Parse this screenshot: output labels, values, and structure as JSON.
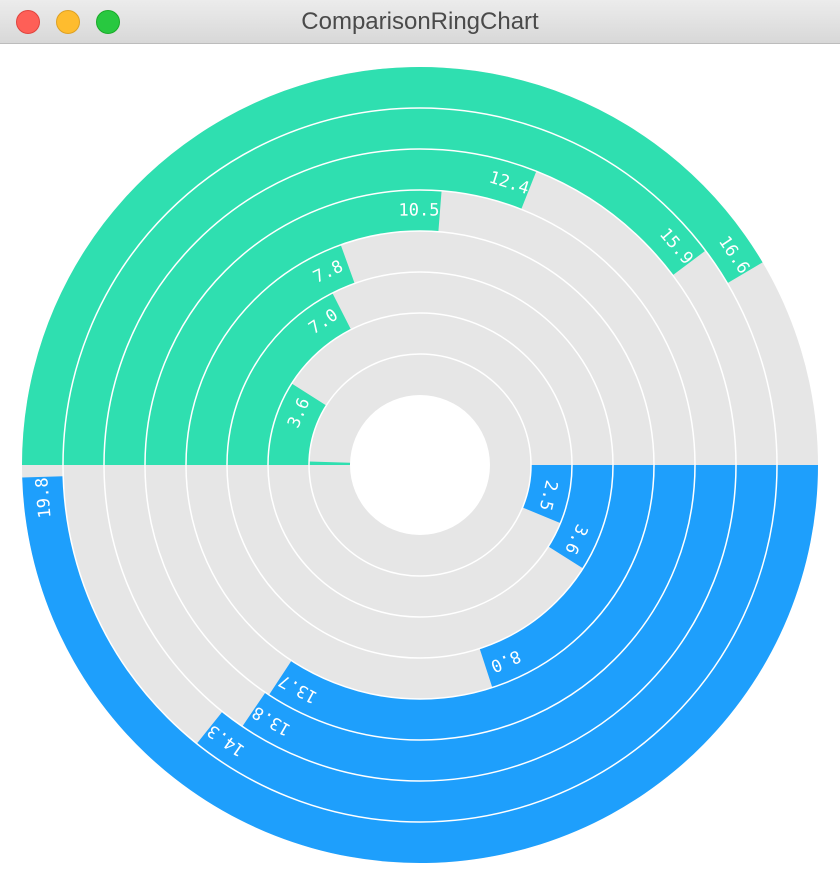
{
  "window": {
    "title": "ComparisonRingChart"
  },
  "chart_data": {
    "type": "ring",
    "max": 20,
    "track_color": "#e6e6e6",
    "series": [
      {
        "color": "#2fdfb0",
        "direction": "top-half",
        "values": [
          0.2,
          3.6,
          7.0,
          7.8,
          10.5,
          12.4,
          15.9,
          16.6
        ],
        "labels": [
          "",
          "3.6",
          "7.0",
          "7.8",
          "10.5",
          "12.4",
          "15.9",
          "16.6"
        ]
      },
      {
        "color": "#1e9ffc",
        "direction": "bottom-half",
        "values": [
          2.5,
          3.6,
          8.0,
          13.7,
          13.8,
          14.3,
          19.8
        ],
        "labels": [
          "2.5",
          "3.6",
          "8.0",
          "13.7",
          "13.8",
          "14.3",
          "19.8"
        ]
      }
    ]
  }
}
